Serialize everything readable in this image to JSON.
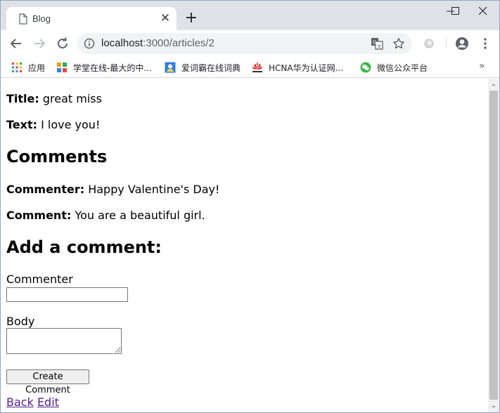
{
  "tab": {
    "title": "Blog"
  },
  "address_bar": {
    "host": "localhost",
    "path": ":3000/articles/2"
  },
  "bookmarks": [
    {
      "label": "应用",
      "icon": "apps-grid-icon"
    },
    {
      "label": "学堂在线-最大的中...",
      "icon": "xuetang-logo-icon"
    },
    {
      "label": "爱词霸在线词典",
      "icon": "iciba-logo-icon"
    },
    {
      "label": "HCNA华为认证网...",
      "icon": "huawei-logo-icon"
    },
    {
      "label": "微信公众平台",
      "icon": "wechat-logo-icon"
    }
  ],
  "article": {
    "title_label": "Title:",
    "title_value": "great miss",
    "text_label": "Text:",
    "text_value": "I love you!"
  },
  "comments": {
    "heading": "Comments",
    "items": [
      {
        "commenter_label": "Commenter:",
        "commenter_value": "Happy Valentine's Day!",
        "comment_label": "Comment:",
        "comment_value": "You are a beautiful girl."
      }
    ]
  },
  "form": {
    "heading": "Add a comment:",
    "commenter_label": "Commenter",
    "commenter_value": "",
    "body_label": "Body",
    "body_value": "",
    "submit_label": "Create Comment"
  },
  "links": {
    "back": "Back",
    "edit": "Edit"
  }
}
